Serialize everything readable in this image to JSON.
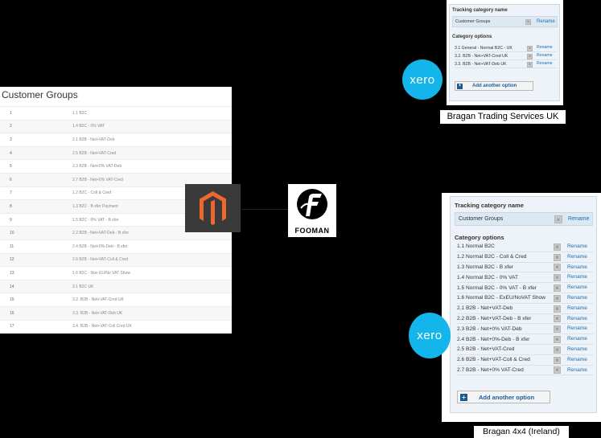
{
  "customer_groups": {
    "title": "Customer Groups",
    "rows": [
      {
        "num": "1",
        "name": "1.1 B2C"
      },
      {
        "num": "2",
        "name": "1.4 B2C - 0% VAT"
      },
      {
        "num": "3",
        "name": "2.1 B2B - Net+VAT-Deb"
      },
      {
        "num": "4",
        "name": "2.5 B2B - Net+VAT-Cred"
      },
      {
        "num": "5",
        "name": "2.3 B2B - Net+0% VAT-Deb"
      },
      {
        "num": "6",
        "name": "2.7 B2B - Net+0% VAT-Cred"
      },
      {
        "num": "7",
        "name": "1.2 B2C - Coll & Cred"
      },
      {
        "num": "8",
        "name": "1.3 B2C - B xfer Payment"
      },
      {
        "num": "9",
        "name": "1.5 B2C - 0% VAT - B xfer"
      },
      {
        "num": "10",
        "name": "2.2 B2B - Net+VAT-Deb - B xfer"
      },
      {
        "num": "11",
        "name": "2.4 B2B - Net+0%-Deb - B xfer"
      },
      {
        "num": "12",
        "name": "2.6 B2B - Net+VAT-Coll & Cred"
      },
      {
        "num": "13",
        "name": "1.6 B2C - Non EU/No VAT Show"
      },
      {
        "num": "14",
        "name": "3.1 B2C UK"
      },
      {
        "num": "15",
        "name": "3.2. B2B - Net+VAT-Cred UK"
      },
      {
        "num": "16",
        "name": "3.3. B2B - Net+VAT-Deb UK"
      },
      {
        "num": "17",
        "name": "3.4. B2B - Net+VAT-Coll Cred UK"
      }
    ]
  },
  "logos": {
    "xero_text": "xero",
    "fooman_text": "FOOMAN"
  },
  "xero_uk": {
    "tracking_label": "Tracking category name",
    "tracking_value": "Customer Groups",
    "rename_label": "Rename",
    "remove_glyph": "×",
    "options_label": "Category options",
    "options": [
      "3.1 General - Normal B2C - UK",
      "3.2. B2B - Net+VAT-Cred UK",
      "3.3. B2B - Net+VAT-Deb UK"
    ],
    "add_label": "Add another option",
    "add_icon": "+",
    "caption": "Bragan Trading Services UK"
  },
  "xero_ie": {
    "tracking_label": "Tracking category name",
    "tracking_value": "Customer Groups",
    "rename_label": "Rename",
    "remove_glyph": "×",
    "options_label": "Category options",
    "options": [
      "1.1 Normal B2C",
      "1.2 Normal B2C - Coll & Cred",
      "1.3 Normal B2C - B xfer",
      "1.4 Normal B2C - 0% VAT",
      "1.5 Normal B2C - 0% VAT - B xfer",
      "1.6 Normal B2C - ExEU/NoVAT Show",
      "2.1 B2B - Net+VAT-Deb",
      "2.2 B2B - Net+VAT-Deb - B xfer",
      "2.3 B2B - Net+0% VAT-Deb",
      "2.4 B2B - Net+0%-Deb - B xfer",
      "2.5 B2B - Net+VAT-Cred",
      "2.6 B2B - Net+VAT-Coll & Cred",
      "2.7 B2B - Net+0% VAT-Cred"
    ],
    "add_label": "Add another option",
    "add_icon": "+",
    "caption": "Bragan 4x4 (Ireland)"
  },
  "colors": {
    "background": "#000000",
    "magento_orange": "#ee672f",
    "xero_blue": "#13b5ea",
    "link_blue": "#1a6fb3"
  }
}
